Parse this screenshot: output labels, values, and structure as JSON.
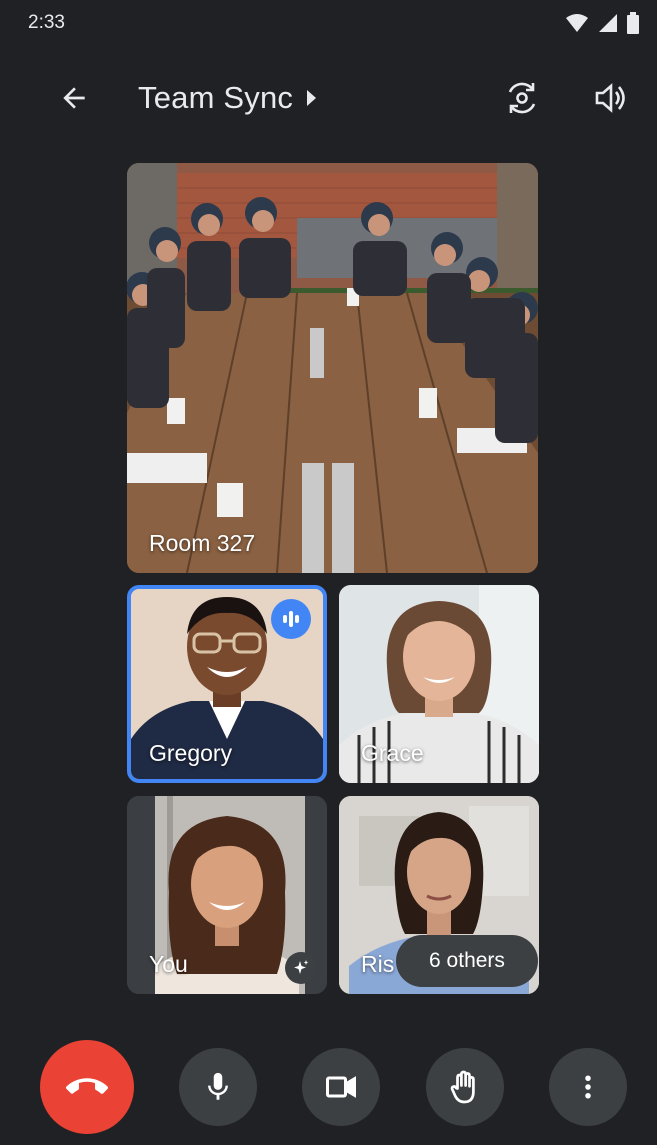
{
  "status_bar": {
    "time": "2:33",
    "icons": [
      "wifi-icon",
      "cell-signal-icon",
      "battery-icon"
    ]
  },
  "app_bar": {
    "back_icon": "arrow-back-icon",
    "title": "Team Sync",
    "title_chevron_icon": "chevron-right-icon",
    "switch_camera_icon": "switch-camera-icon",
    "speaker_icon": "speaker-icon"
  },
  "tiles": {
    "room": {
      "name": "Room 327"
    },
    "gregory": {
      "name": "Gregory",
      "speaking": true
    },
    "grace": {
      "name": "Grace"
    },
    "you": {
      "name": "You"
    },
    "rise": {
      "name": "Ris"
    }
  },
  "others_pill": {
    "label": "6 others"
  },
  "controls": {
    "end_call_icon": "hang-up-icon",
    "mic_icon": "microphone-icon",
    "camera_icon": "video-camera-icon",
    "hand_icon": "raise-hand-icon",
    "more_icon": "more-vert-icon"
  },
  "colors": {
    "background": "#202124",
    "surface": "#3c4043",
    "accent_blue": "#4285f4",
    "end_call_red": "#ea4335",
    "text": "#e8eaed"
  }
}
